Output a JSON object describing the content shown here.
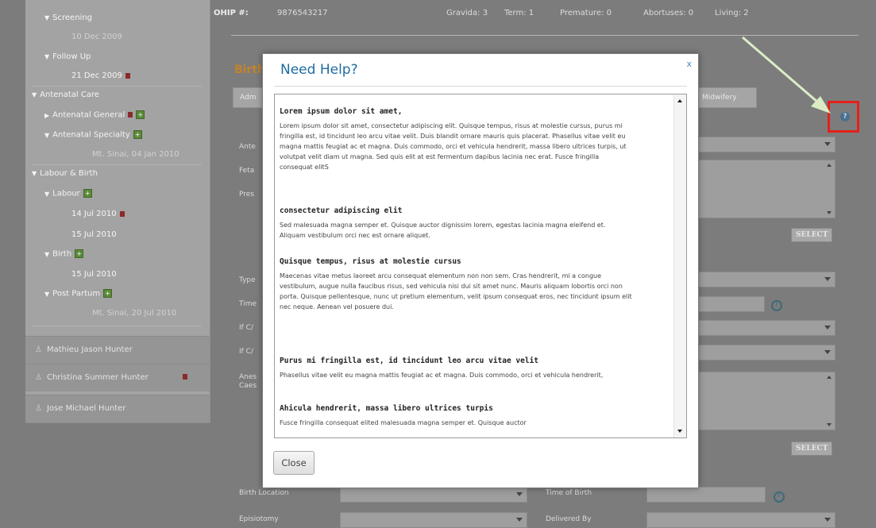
{
  "sidebar": {
    "tree": [
      {
        "label": "Screening",
        "kind": "sub"
      },
      {
        "label": "10 Dec 2009",
        "kind": "date"
      },
      {
        "label": "Follow Up",
        "kind": "sub"
      },
      {
        "label": "21 Dec 2009",
        "kind": "date-bold"
      },
      {
        "label": "Antenatal Care",
        "kind": "head"
      },
      {
        "label": "Antenatal General",
        "kind": "sub"
      },
      {
        "label": "Antenatal Specialty",
        "kind": "sub"
      },
      {
        "label": "Mt. Sinai, 04 Jan 2010",
        "kind": "date"
      },
      {
        "label": "Labour & Birth",
        "kind": "head"
      },
      {
        "label": "Labour",
        "kind": "sub"
      },
      {
        "label": "14 Jul 2010",
        "kind": "date-bold"
      },
      {
        "label": "15 Jul 2010",
        "kind": "date-bold"
      },
      {
        "label": "Birth",
        "kind": "sub"
      },
      {
        "label": "15 Jul 2010",
        "kind": "date-bold"
      },
      {
        "label": "Post Partum",
        "kind": "sub"
      },
      {
        "label": "Mt. Sinai, 20 Jul 2010",
        "kind": "date"
      }
    ],
    "patients": [
      "Mathieu Jason Hunter",
      "Christina Summer Hunter",
      "Jose Michael Hunter"
    ]
  },
  "header": {
    "ohip_label": "OHIP #:",
    "ohip_value": "9876543217",
    "gravida": "Gravida: 3",
    "term": "Term: 1",
    "premature": "Premature: 0",
    "abortuses": "Abortuses: 0",
    "living": "Living: 2"
  },
  "main": {
    "section_title": "Birth",
    "tab_left": "Adm",
    "tab_right": "Midwifery",
    "labels": {
      "ante": "Ante",
      "feta": "Feta",
      "pres": "Pres",
      "type": "Type",
      "time": "Time",
      "ifc1": "If C/",
      "ifc2": "If C/",
      "anes": "Anes",
      "caes": "Caes",
      "birth_location": "Birth Location",
      "time_of_birth": "Time of Birth",
      "episiotomy": "Episiotomy",
      "delivered_by": "Delivered By"
    },
    "select_btn": "SELECT"
  },
  "modal": {
    "title": "Need Help?",
    "close_x": "x",
    "close_button": "Close",
    "sections": [
      {
        "heading": "Lorem ipsum dolor sit amet,",
        "body": "Lorem ipsum dolor sit amet, consectetur adipiscing elit. Quisque tempus, risus at molestie cursus, purus mi fringilla est, id tincidunt leo arcu vitae velit. Duis blandit ornare mauris quis placerat. Phasellus vitae velit eu magna mattis feugiat ac et magna. Duis commodo, orci et vehicula hendrerit, massa libero ultrices turpis, ut volutpat velit diam ut magna. Sed quis elit at est fermentum dapibus lacinia nec erat. Fusce fringilla consequat elitS"
      },
      {
        "heading": "consectetur adipiscing elit",
        "body": "Sed malesuada magna semper et. Quisque auctor dignissim lorem, egestas lacinia magna eleifend et. Aliquam vestibulum orci nec est ornare aliquet."
      },
      {
        "heading": "Quisque tempus, risus at molestie cursus",
        "body": "Maecenas vitae metus laoreet arcu consequat elementum non non sem. Cras hendrerit, mi a congue vestibulum, augue nulla faucibus risus, sed vehicula nisi dui sit amet nunc. Mauris aliquam lobortis orci non porta. Quisque pellentesque, nunc ut pretium elementum, velit ipsum consequat eros, nec tincidunt ipsum elit nec neque. Aenean vel posuere dui."
      },
      {
        "heading": "Purus mi fringilla est, id tincidunt leo arcu vitae velit",
        "body": "Phasellus vitae velit eu magna mattis feugiat ac et magna. Duis commodo, orci et vehicula hendrerit,"
      },
      {
        "heading": "Ahicula hendrerit, massa libero ultrices turpis",
        "body": "Fusce fringilla consequat elited malesuada magna semper et. Quisque auctor"
      }
    ]
  },
  "help_icon": "help-icon",
  "colors": {
    "highlight": "#e4201b",
    "modal_title": "#1d6ca2",
    "birth_title": "#c2832b",
    "overlay": "#7c7c7c",
    "arrow": "#d9ecc6"
  }
}
